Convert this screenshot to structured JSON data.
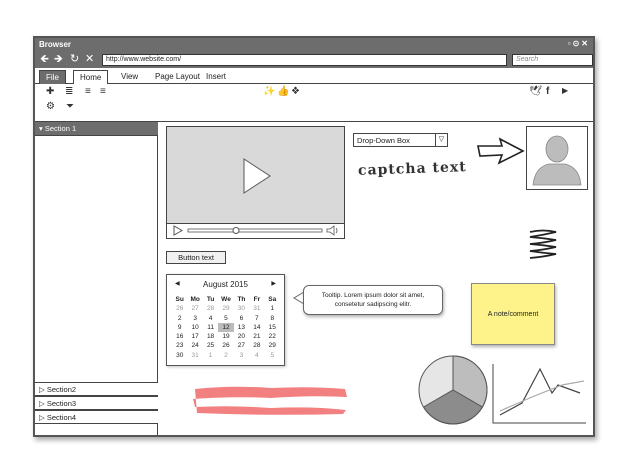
{
  "window": {
    "title": "Browser",
    "controls": "▫⊙✕"
  },
  "nav": {
    "back": "🡸",
    "forward": "🡺",
    "reload": "↻",
    "stop": "✕"
  },
  "address": {
    "url": "http://www.website.com/",
    "search_placeholder": "Search"
  },
  "tabs": [
    {
      "label": "File"
    },
    {
      "label": "Home"
    },
    {
      "label": "View"
    },
    {
      "label": "Page Layout"
    },
    {
      "label": "Insert"
    }
  ],
  "sidebar": {
    "sections": [
      {
        "label": "Section 1",
        "icon": "▾"
      },
      {
        "label": "Section2",
        "icon": "▷"
      },
      {
        "label": "Section3",
        "icon": "▷"
      },
      {
        "label": "Section4",
        "icon": "▷"
      }
    ]
  },
  "button": {
    "label": "Button text"
  },
  "dropdown": {
    "value": "Drop-Down Box",
    "arrow": "▽"
  },
  "captcha": {
    "text": "captcha text"
  },
  "calendar": {
    "month": "August 2015",
    "prev": "◀",
    "next": "▶",
    "days_of_week": [
      "Su",
      "Mo",
      "Tu",
      "We",
      "Th",
      "Fr",
      "Sa"
    ],
    "weeks": [
      [
        "26",
        "27",
        "28",
        "29",
        "30",
        "31",
        "1"
      ],
      [
        "2",
        "3",
        "4",
        "5",
        "6",
        "7",
        "8"
      ],
      [
        "9",
        "10",
        "11",
        "12",
        "13",
        "14",
        "15"
      ],
      [
        "16",
        "17",
        "18",
        "19",
        "20",
        "21",
        "22"
      ],
      [
        "23",
        "24",
        "25",
        "26",
        "27",
        "28",
        "29"
      ],
      [
        "30",
        "31",
        "1",
        "2",
        "3",
        "4",
        "5"
      ]
    ],
    "selected": "12"
  },
  "tooltip": {
    "text": "Tooltip. Lorem ipsum dolor sit amet, consetetur sadipscing elitr."
  },
  "note": {
    "text": "A note/comment"
  },
  "colors": {
    "chrome": "#6d6d6d",
    "note": "#fdf38a",
    "highlight": "#f28080"
  }
}
